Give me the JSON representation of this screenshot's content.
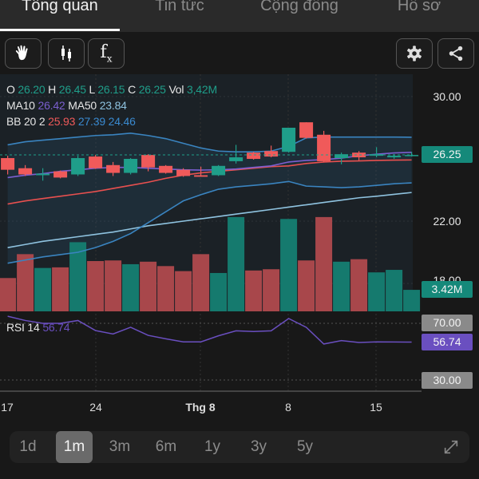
{
  "tabs": [
    {
      "label": "Tổng quan",
      "active": true
    },
    {
      "label": "Tin tức"
    },
    {
      "label": "Cộng đồng"
    },
    {
      "label": "Hồ sơ"
    }
  ],
  "toolbar": {
    "left": [
      "hand-icon",
      "candlestick-icon",
      "function-fx-icon"
    ],
    "fx_label": "f",
    "fx_sub": "x",
    "right": [
      "gear-icon",
      "share-icon"
    ]
  },
  "legend": {
    "ohlc": {
      "o_label": "O",
      "o": "26.20",
      "h_label": "H",
      "h": "26.45",
      "l_label": "L",
      "l": "26.15",
      "c_label": "C",
      "c": "26.25",
      "vol_label": "Vol",
      "vol": "3,42M"
    },
    "ma": {
      "ma10_label": "MA10",
      "ma10": "26.42",
      "ma50_label": "MA50",
      "ma50": "23.84"
    },
    "bb": {
      "label": "BB 20 2",
      "mid": "25.93",
      "upper": "27.39",
      "lower": "24.46"
    },
    "rsi": {
      "label": "RSI 14",
      "value": "56.74"
    }
  },
  "price_axis": {
    "ticks": [
      "30.00",
      "22.00",
      "18.00"
    ],
    "last_price": "26.25",
    "last_volume": "3.42M"
  },
  "rsi_axis": {
    "upper": "70.00",
    "value": "56.74",
    "lower": "30.00"
  },
  "dates": [
    "17",
    "24",
    "Thg 8",
    "8",
    "15"
  ],
  "ranges": [
    {
      "label": "1d"
    },
    {
      "label": "1m",
      "active": true
    },
    {
      "label": "3m"
    },
    {
      "label": "6m"
    },
    {
      "label": "1y"
    },
    {
      "label": "3y"
    },
    {
      "label": "5y"
    }
  ],
  "expand_icon": "expand-icon",
  "colors": {
    "up": "#1f9e8a",
    "down": "#f05a5a",
    "vol_up": "#157a6e",
    "vol_down": "#a8474b",
    "ma10": "#7b5fd0",
    "ma50": "#8fc3e0",
    "bb_band": "#3a84c0",
    "bb_mid": "#e8504f",
    "rsi": "#6a4fc0",
    "badge_green": "#15897a",
    "badge_gray": "#8a8a8a"
  },
  "chart_data": {
    "type": "candlestick",
    "ohlc": [
      [
        26.05,
        26.2,
        25.0,
        25.3
      ],
      [
        25.4,
        25.6,
        24.9,
        25.0
      ],
      [
        24.95,
        25.4,
        24.6,
        25.05
      ],
      [
        25.2,
        25.25,
        24.75,
        24.8
      ],
      [
        25.0,
        26.2,
        24.9,
        26.05
      ],
      [
        26.15,
        26.25,
        25.35,
        25.4
      ],
      [
        25.6,
        25.8,
        24.9,
        25.1
      ],
      [
        25.1,
        26.05,
        25.0,
        26.0
      ],
      [
        26.25,
        26.3,
        25.2,
        25.45
      ],
      [
        25.55,
        25.6,
        25.05,
        25.1
      ],
      [
        25.3,
        25.4,
        24.85,
        24.9
      ],
      [
        24.95,
        25.5,
        24.85,
        24.85
      ],
      [
        24.95,
        25.6,
        24.9,
        25.55
      ],
      [
        25.85,
        26.9,
        25.7,
        26.1
      ],
      [
        26.4,
        26.45,
        25.95,
        26.0
      ],
      [
        26.5,
        26.85,
        26.1,
        26.15
      ],
      [
        26.45,
        28.0,
        26.4,
        28.0
      ],
      [
        28.35,
        28.35,
        27.3,
        27.35
      ],
      [
        27.55,
        27.8,
        25.8,
        25.85
      ],
      [
        26.05,
        26.4,
        25.65,
        26.3
      ],
      [
        26.4,
        26.5,
        25.9,
        26.1
      ],
      [
        26.2,
        26.75,
        26.1,
        26.3
      ],
      [
        26.1,
        26.3,
        26.0,
        26.2
      ],
      [
        26.2,
        26.45,
        26.15,
        26.25
      ]
    ],
    "volume_m": [
      5.3,
      9.1,
      6.9,
      7.0,
      11.0,
      8.0,
      8.1,
      7.5,
      7.9,
      7.2,
      6.4,
      9.1,
      6.1,
      15.0,
      6.5,
      6.7,
      14.7,
      8.1,
      15.0,
      7.9,
      8.3,
      6.2,
      6.6,
      3.42
    ],
    "ma10": [
      24.8,
      24.95,
      25.05,
      25.2,
      25.3,
      25.4,
      25.45,
      25.45,
      25.4,
      25.35,
      25.3,
      25.28,
      25.3,
      25.35,
      25.45,
      25.55,
      25.8,
      25.9,
      25.95,
      26.05,
      26.2,
      26.3,
      26.38,
      26.42
    ],
    "ma50": [
      20.3,
      20.5,
      20.7,
      20.85,
      21.0,
      21.15,
      21.3,
      21.5,
      21.7,
      21.85,
      22.0,
      22.15,
      22.3,
      22.45,
      22.6,
      22.75,
      22.9,
      23.05,
      23.2,
      23.35,
      23.5,
      23.6,
      23.72,
      23.84
    ],
    "bb_upper": [
      26.9,
      27.1,
      27.2,
      27.3,
      27.4,
      27.5,
      27.55,
      27.65,
      27.5,
      27.3,
      27.0,
      26.7,
      26.5,
      26.45,
      26.45,
      26.5,
      26.8,
      27.35,
      27.4,
      27.4,
      27.4,
      27.4,
      27.4,
      27.39
    ],
    "bb_mid": [
      23.1,
      23.3,
      23.45,
      23.6,
      23.75,
      23.9,
      24.1,
      24.3,
      24.5,
      24.75,
      24.95,
      25.1,
      25.2,
      25.3,
      25.4,
      25.5,
      25.55,
      25.7,
      25.8,
      25.85,
      25.87,
      25.9,
      25.92,
      25.93
    ],
    "bb_lower": [
      19.3,
      19.5,
      19.7,
      19.85,
      20.0,
      20.3,
      20.7,
      21.2,
      21.9,
      22.6,
      23.3,
      23.7,
      24.05,
      24.2,
      24.3,
      24.4,
      24.55,
      24.25,
      24.2,
      24.15,
      24.2,
      24.3,
      24.4,
      24.46
    ],
    "rsi": [
      75,
      72,
      70,
      70,
      72,
      64.9,
      62.5,
      67.2,
      61.5,
      59.1,
      56.9,
      56.9,
      61.2,
      64.7,
      64.2,
      64.7,
      73.4,
      67.2,
      55.4,
      57.8,
      56.5,
      56.9,
      56.8,
      56.74
    ],
    "rsi_levels": [
      70,
      30
    ]
  }
}
